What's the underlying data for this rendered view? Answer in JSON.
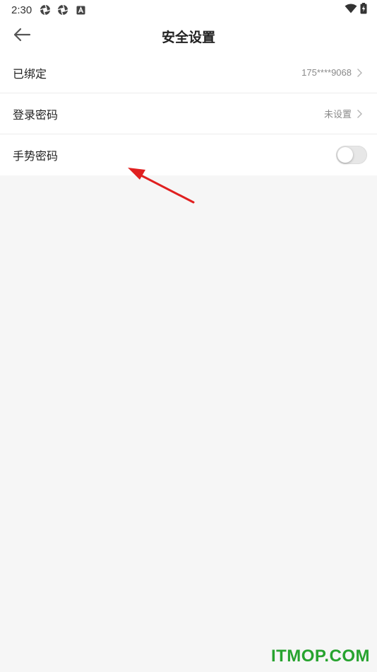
{
  "status_bar": {
    "time": "2:30",
    "icons": [
      "aperture-icon",
      "aperture-icon",
      "a-box-icon"
    ],
    "right_icons": [
      "wifi-icon",
      "battery-charging-icon"
    ]
  },
  "header": {
    "title": "安全设置",
    "back_icon": "arrow-left-icon"
  },
  "settings": {
    "bound": {
      "label": "已绑定",
      "value": "175****9068"
    },
    "login_password": {
      "label": "登录密码",
      "value": "未设置"
    },
    "gesture_password": {
      "label": "手势密码",
      "enabled": false
    }
  },
  "colors": {
    "background": "#f6f6f6",
    "annotation_arrow": "#e02020",
    "watermark": "#27a32f"
  },
  "watermark": {
    "text": "ITMOP.COM"
  }
}
